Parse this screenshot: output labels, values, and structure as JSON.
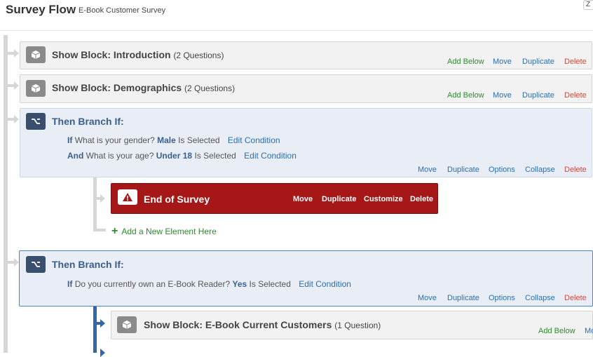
{
  "header": {
    "title": "Survey Flow",
    "subtitle": "E-Book Customer Survey",
    "corner_button": "Z"
  },
  "blocks": [
    {
      "label": "Show Block: Introduction",
      "count": "(2 Questions)",
      "actions": {
        "add_below": "Add Below",
        "move": "Move",
        "duplicate": "Duplicate",
        "delete": "Delete"
      }
    },
    {
      "label": "Show Block: Demographics",
      "count": "(2 Questions)",
      "actions": {
        "add_below": "Add Below",
        "move": "Move",
        "duplicate": "Duplicate",
        "delete": "Delete"
      }
    }
  ],
  "branch1": {
    "title": "Then Branch If:",
    "conditions": [
      {
        "conj": "If",
        "question": "What is your gender?",
        "value": "Male",
        "op": "Is  Selected",
        "edit": "Edit Condition"
      },
      {
        "conj": "And",
        "question": "What is your age?",
        "value": "Under 18",
        "op": "Is  Selected",
        "edit": "Edit Condition"
      }
    ],
    "actions": {
      "move": "Move",
      "duplicate": "Duplicate",
      "options": "Options",
      "collapse": "Collapse",
      "delete": "Delete"
    },
    "end_of_survey": {
      "title": "End of Survey",
      "actions": {
        "move": "Move",
        "duplicate": "Duplicate",
        "customize": "Customize",
        "delete": "Delete"
      }
    },
    "add_element": "Add a New Element Here"
  },
  "branch2": {
    "title": "Then Branch If:",
    "conditions": [
      {
        "conj": "If",
        "question": "Do you currently own an E-Book Reader?",
        "value": "Yes",
        "op": "Is  Selected",
        "edit": "Edit Condition"
      }
    ],
    "actions": {
      "move": "Move",
      "duplicate": "Duplicate",
      "options": "Options",
      "collapse": "Collapse",
      "delete": "Delete"
    },
    "child_block": {
      "label": "Show Block: E-Book Current Customers",
      "count": "(1 Question)",
      "actions": {
        "add_below": "Add Below",
        "move": "Mo"
      }
    }
  },
  "colors": {
    "add": "#2f8a2f",
    "link": "#2a6fb0",
    "delete": "#d04a3a",
    "end_of_survey": "#a61717",
    "branch_title": "#3b5f8a"
  },
  "icons": {
    "block": "cube-icon",
    "branch": "branch-icon",
    "warning": "warning-icon",
    "add": "plus-icon"
  }
}
